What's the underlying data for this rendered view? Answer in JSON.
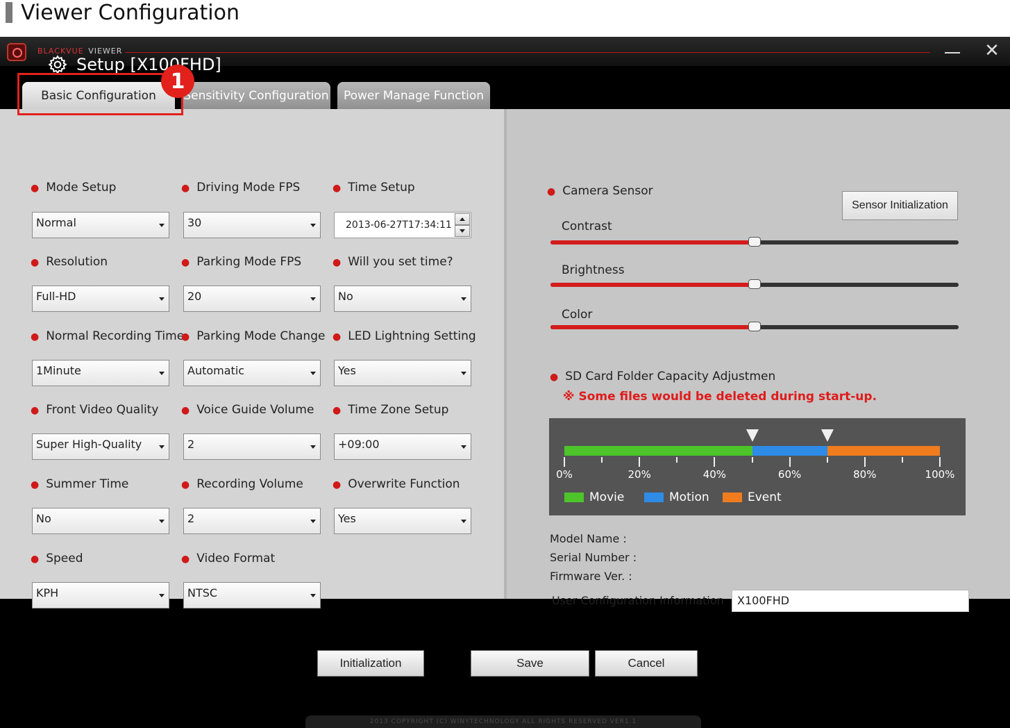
{
  "doc": {
    "title": "Viewer Configuration"
  },
  "app": {
    "brand_name": "BLACKVUE",
    "brand_viewer": "VIEWER",
    "minimize_label": "—",
    "close_label": "✕"
  },
  "setup": {
    "title": "Setup [X100FHD]"
  },
  "callout": {
    "number": "1"
  },
  "tabs": [
    {
      "label": "Basic Configuration"
    },
    {
      "label": "Sensitivity Configuration"
    },
    {
      "label": "Power Manage Function"
    }
  ],
  "fields": {
    "mode_setup": {
      "label": "Mode Setup",
      "value": "Normal"
    },
    "driving_fps": {
      "label": "Driving Mode FPS",
      "value": "30"
    },
    "time_setup": {
      "label": "Time Setup",
      "value": "2013-06-27T17:34:11"
    },
    "resolution": {
      "label": "Resolution",
      "value": "Full-HD"
    },
    "parking_fps": {
      "label": "Parking Mode FPS",
      "value": "20"
    },
    "set_time": {
      "label": "Will you set time?",
      "value": "No"
    },
    "normal_rec_time": {
      "label": "Normal Recording Time",
      "value": "1Minute"
    },
    "parking_change": {
      "label": "Parking Mode Change",
      "value": "Automatic"
    },
    "led": {
      "label": "LED Lightning Setting",
      "value": "Yes"
    },
    "front_quality": {
      "label": "Front Video Quality",
      "value": "Super High-Quality"
    },
    "voice_volume": {
      "label": "Voice Guide Volume",
      "value": "2"
    },
    "time_zone": {
      "label": "Time Zone Setup",
      "value": "+09:00"
    },
    "summer_time": {
      "label": "Summer Time",
      "value": "No"
    },
    "rec_volume": {
      "label": "Recording Volume",
      "value": "2"
    },
    "overwrite": {
      "label": "Overwrite Function",
      "value": "Yes"
    },
    "speed": {
      "label": "Speed",
      "value": "KPH"
    },
    "video_format": {
      "label": "Video Format",
      "value": "NTSC"
    }
  },
  "sensor": {
    "label": "Camera Sensor",
    "init_button": "Sensor Initialization",
    "contrast_label": "Contrast",
    "contrast_level": 0.5,
    "brightness_label": "Brightness",
    "brightness_level": 0.5,
    "color_label": "Color",
    "color_level": 0.5
  },
  "sdcard": {
    "label": "SD Card Folder Capacity Adjustmen",
    "warning": "※ Some files would be deleted during start-up.",
    "movie_pct": 50,
    "motion_pct": 20,
    "event_pct": 30,
    "ticks": [
      "0%",
      "20%",
      "40%",
      "60%",
      "80%",
      "100%"
    ],
    "legend": {
      "movie": "Movie",
      "motion": "Motion",
      "event": "Event"
    },
    "colors": {
      "movie": "#4cc42a",
      "motion": "#2e8be6",
      "event": "#f07c1e"
    }
  },
  "info": {
    "model_name": "Model Name :",
    "serial_number": "Serial Number :",
    "firmware": "Firmware Ver. :",
    "user_config_label": "User Configuration Information",
    "user_config_value": "X100FHD"
  },
  "buttons": {
    "initialization": "Initialization",
    "save": "Save",
    "cancel": "Cancel"
  },
  "footer": {
    "text": "2013 COPYRIGHT (C) WINYTECHNOLOGY ALL RIGHTS RESERVED VER1.1"
  },
  "accent_color": "#e2211c"
}
